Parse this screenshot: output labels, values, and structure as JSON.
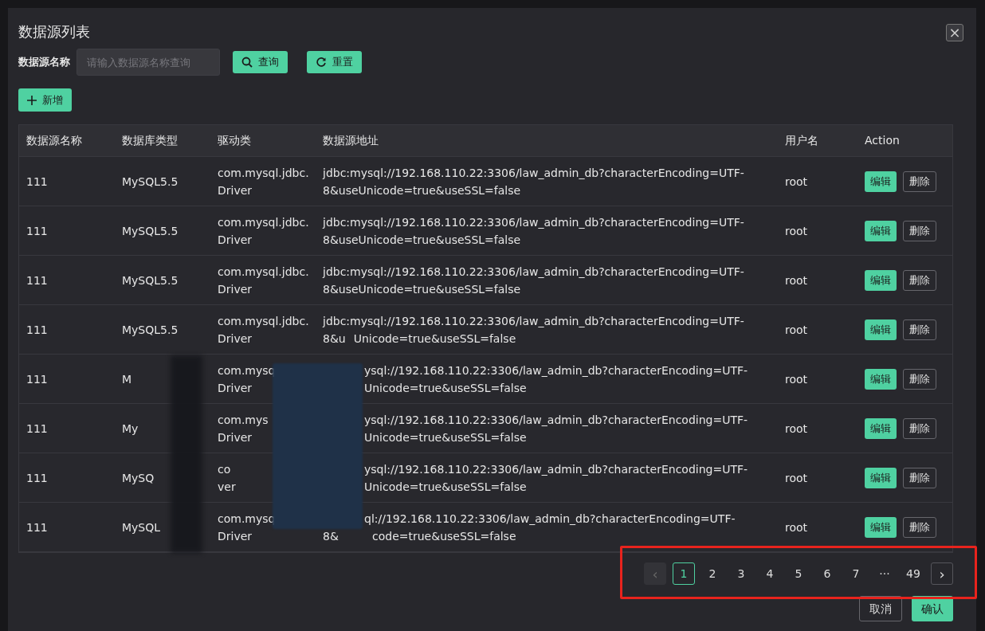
{
  "dialog": {
    "title": "数据源列表",
    "close": "×"
  },
  "filter": {
    "label": "数据源名称",
    "placeholder": "请输入数据源名称查询",
    "buttons": [
      {
        "kind": "search",
        "label": "查询"
      },
      {
        "kind": "reset",
        "label": "重置"
      }
    ]
  },
  "add_button": {
    "label": "新增"
  },
  "table": {
    "columns": [
      "数据源名称",
      "数据库类型",
      "驱动类",
      "数据源地址",
      "用户名",
      "Action"
    ],
    "rows": [
      {
        "kind": "plain",
        "name": "111",
        "type": "MySQL5.5",
        "driver": [
          "com.mysql.jdbc.",
          "Driver"
        ],
        "address": [
          [
            "jdbc:mysql://192.168.110.22:3306/law_admin_db?characterEncoding=UTF-"
          ],
          [
            "8&useUnicode=true&useSSL=false"
          ]
        ],
        "user": "root",
        "actions": [
          "编辑",
          "删除"
        ]
      },
      {
        "kind": "plain",
        "name": "111",
        "type": "MySQL5.5",
        "driver": [
          "com.mysql.jdbc.",
          "Driver"
        ],
        "address": [
          [
            "jdbc:mysql://192.168.110.22:3306/law_admin_db?characterEncoding=UTF-"
          ],
          [
            "8&useUnicode=true&useSSL=false"
          ]
        ],
        "user": "root",
        "actions": [
          "编辑",
          "删除"
        ]
      },
      {
        "kind": "plain",
        "name": "111",
        "type": "MySQL5.5",
        "driver": [
          "com.mysql.jdbc.",
          "Driver"
        ],
        "address": [
          [
            "jdbc:mysql://192.168.110.22:3306/law_admin_db?characterEncoding=UTF-"
          ],
          [
            "8&useUnicode=true&useSSL=false"
          ]
        ],
        "user": "root",
        "actions": [
          "编辑",
          "删除"
        ]
      },
      {
        "kind": "plain",
        "name": "111",
        "type": "MySQL5.5",
        "driver": [
          "com.mysql.jdbc.",
          "Driver"
        ],
        "address": [
          [
            "jdbc:mysql://192.168.110.22:3306/law_admin_db?characterEncoding=UTF-"
          ],
          [
            "8&u",
            "Unicode=true&useSSL=false"
          ]
        ],
        "user": "root",
        "actions": [
          "编辑",
          "删除"
        ]
      },
      {
        "kind": "obscured",
        "name": "111",
        "type": "M",
        "driver": [
          "com.mysq",
          "Driver"
        ],
        "address": [
          [
            "ysql://192.168.110.22:3306/law_admin_db?characterEncoding=UTF-"
          ],
          [
            "Unicode=true&useSSL=false"
          ]
        ],
        "user": "root",
        "actions": [
          "编辑",
          "删除"
        ]
      },
      {
        "kind": "obscured",
        "name": "111",
        "type": "My",
        "driver": [
          "com.mys",
          "Driver"
        ],
        "address": [
          [
            "ysql://192.168.110.22:3306/law_admin_db?characterEncoding=UTF-"
          ],
          [
            "Unicode=true&useSSL=false"
          ]
        ],
        "user": "root",
        "actions": [
          "编辑",
          "删除"
        ]
      },
      {
        "kind": "obscured",
        "name": "111",
        "type": "MySQ",
        "driver": [
          "co",
          "ver"
        ],
        "address": [
          [
            "ysql://192.168.110.22:3306/law_admin_db?characterEncoding=UTF-"
          ],
          [
            "Unicode=true&useSSL=false"
          ]
        ],
        "user": "root",
        "actions": [
          "编辑",
          "删除"
        ]
      },
      {
        "kind": "obscured",
        "name": "111",
        "type": "MySQL",
        "driver": [
          "com.mysq",
          "Driver"
        ],
        "address": [
          [
            "ql://192.168.110.22:3306/law_admin_db?characterEncoding=UTF-"
          ],
          [
            "8&",
            "code=true&useSSL=false"
          ]
        ],
        "user": "root",
        "actions": [
          "编辑",
          "删除"
        ]
      }
    ]
  },
  "pagination": {
    "highlighted": true,
    "prev": {
      "label": "‹",
      "disabled": true
    },
    "pages": [
      {
        "label": "1",
        "selected": true
      },
      {
        "label": "2",
        "selected": false
      },
      {
        "label": "3",
        "selected": false
      },
      {
        "label": "4",
        "selected": false
      },
      {
        "label": "5",
        "selected": false
      },
      {
        "label": "6",
        "selected": false
      },
      {
        "label": "7",
        "selected": false
      },
      {
        "label": "···",
        "selected": false
      },
      {
        "label": "49",
        "selected": false
      }
    ],
    "next": {
      "label": "›",
      "disabled": false
    }
  },
  "footer": {
    "buttons": [
      {
        "kind": "secondary",
        "label": "取消"
      },
      {
        "kind": "primary",
        "label": "确认"
      }
    ]
  }
}
